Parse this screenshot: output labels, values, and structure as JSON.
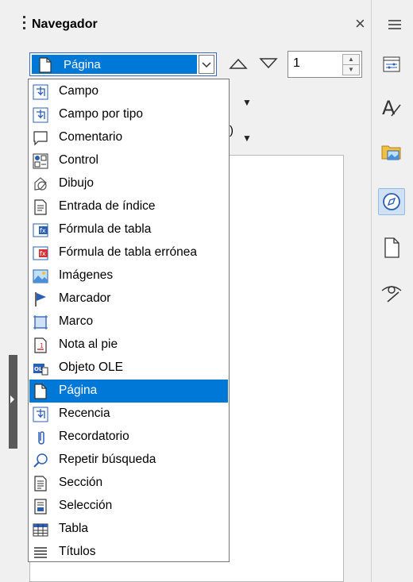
{
  "panel": {
    "title": "Navegador",
    "close_icon": "close-icon",
    "menu_icon": "hamburger-menu-icon"
  },
  "selector": {
    "value": "Página"
  },
  "spin": {
    "value": "1"
  },
  "dropdown": {
    "items": [
      {
        "label": "Campo",
        "icon": "field-icon"
      },
      {
        "label": "Campo por tipo",
        "icon": "field-by-type-icon"
      },
      {
        "label": "Comentario",
        "icon": "comment-icon"
      },
      {
        "label": "Control",
        "icon": "control-icon"
      },
      {
        "label": "Dibujo",
        "icon": "drawing-icon"
      },
      {
        "label": "Entrada de índice",
        "icon": "index-entry-icon"
      },
      {
        "label": "Fórmula de tabla",
        "icon": "table-formula-icon"
      },
      {
        "label": "Fórmula de tabla errónea",
        "icon": "wrong-table-formula-icon"
      },
      {
        "label": "Imágenes",
        "icon": "images-icon"
      },
      {
        "label": "Marcador",
        "icon": "bookmark-icon"
      },
      {
        "label": "Marco",
        "icon": "frame-icon"
      },
      {
        "label": "Nota al pie",
        "icon": "footnote-icon"
      },
      {
        "label": "Objeto OLE",
        "icon": "ole-object-icon"
      },
      {
        "label": "Página",
        "icon": "page-icon",
        "selected": true
      },
      {
        "label": "Recencia",
        "icon": "recency-icon"
      },
      {
        "label": "Recordatorio",
        "icon": "reminder-icon"
      },
      {
        "label": "Repetir búsqueda",
        "icon": "repeat-search-icon"
      },
      {
        "label": "Sección",
        "icon": "section-icon"
      },
      {
        "label": "Selección",
        "icon": "selection-icon"
      },
      {
        "label": "Tabla",
        "icon": "table-icon"
      },
      {
        "label": "Títulos",
        "icon": "headings-icon"
      }
    ]
  },
  "sidebar": {
    "buttons": [
      "properties-icon",
      "styles-icon",
      "gallery-icon",
      "navigator-icon",
      "page-icon",
      "style-inspector-icon"
    ]
  },
  "colors": {
    "selection": "#0078d7",
    "accent": "#2b5fb4"
  }
}
